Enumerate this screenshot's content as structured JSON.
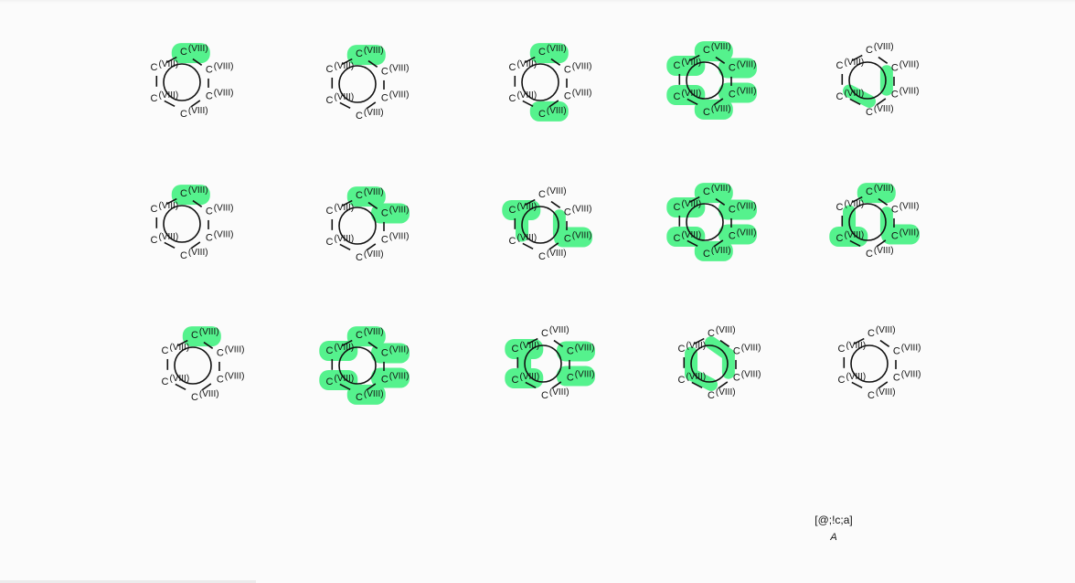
{
  "atom_label": "C",
  "atom_charge": "(VIII)",
  "highlight_color": "#55f28d",
  "bond_color": "#111111",
  "caption": {
    "smarts": "[@;!c;a]",
    "label": "A"
  },
  "panels": [
    {
      "atoms": [
        0
      ],
      "bonds": []
    },
    {
      "atoms": [
        0
      ],
      "bonds": []
    },
    {
      "atoms": [
        0,
        3
      ],
      "bonds": []
    },
    {
      "atoms": [
        0,
        1,
        2,
        3,
        4,
        5
      ],
      "bonds": []
    },
    {
      "atoms": [],
      "bonds": [
        "3-4",
        "1-2"
      ]
    },
    {
      "atoms": [
        0
      ],
      "bonds": []
    },
    {
      "atoms": [
        0,
        1
      ],
      "bonds": []
    },
    {
      "atoms": [
        2,
        5
      ],
      "bonds": [
        "1-2",
        "4-5"
      ]
    },
    {
      "atoms": [
        0,
        1,
        2,
        3,
        4,
        5
      ],
      "bonds": []
    },
    {
      "atoms": [
        0,
        2,
        4
      ],
      "bonds": [
        "1-2",
        "4-5"
      ]
    },
    {
      "atoms": [
        0
      ],
      "bonds": []
    },
    {
      "atoms": [
        0,
        1,
        2,
        3,
        4,
        5
      ],
      "bonds": []
    },
    {
      "atoms": [
        1,
        2,
        4,
        5
      ],
      "bonds": [
        "4-5"
      ]
    },
    {
      "atoms": [],
      "bonds": [
        "0-1",
        "1-2",
        "3-4",
        "4-5"
      ]
    },
    {
      "atoms": [],
      "bonds": []
    }
  ]
}
